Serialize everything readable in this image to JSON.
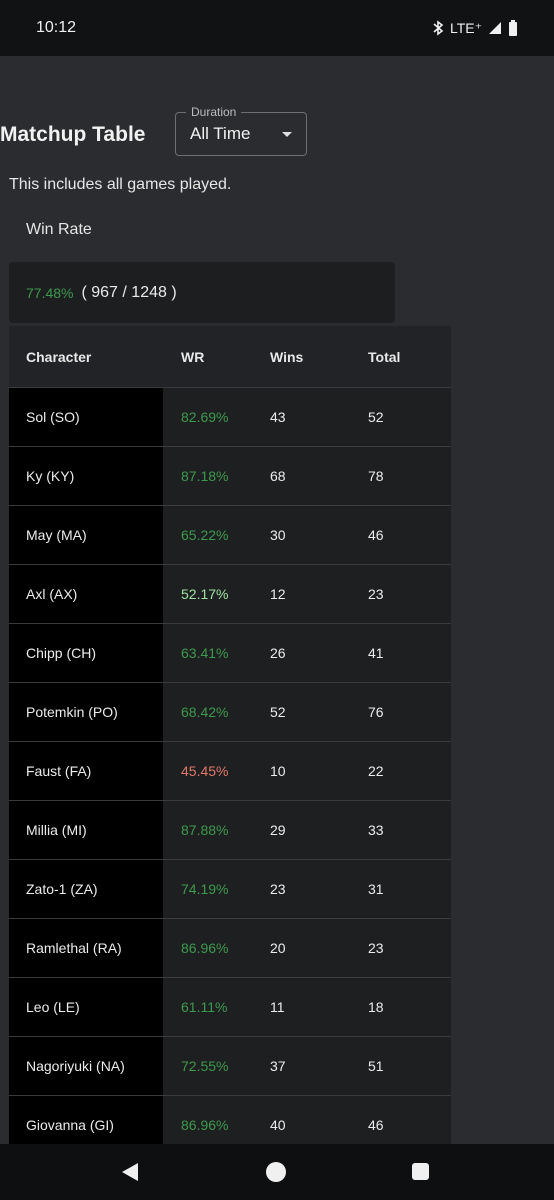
{
  "status": {
    "time": "10:12",
    "network": "LTE⁺"
  },
  "page": {
    "title": "Matchup Table",
    "description": "This includes all games played.",
    "winrate_label": "Win Rate"
  },
  "duration": {
    "label": "Duration",
    "value": "All Time"
  },
  "summary": {
    "pct": "77.48%",
    "count": "( 967 / 1248 )"
  },
  "table": {
    "headers": [
      "Character",
      "WR",
      "Wins",
      "Total"
    ],
    "rows": [
      {
        "character": "Sol (SO)",
        "wr": "82.69%",
        "wins": "43",
        "total": "52",
        "tone": "green"
      },
      {
        "character": "Ky (KY)",
        "wr": "87.18%",
        "wins": "68",
        "total": "78",
        "tone": "green"
      },
      {
        "character": "May (MA)",
        "wr": "65.22%",
        "wins": "30",
        "total": "46",
        "tone": "green"
      },
      {
        "character": "Axl (AX)",
        "wr": "52.17%",
        "wins": "12",
        "total": "23",
        "tone": "light"
      },
      {
        "character": "Chipp (CH)",
        "wr": "63.41%",
        "wins": "26",
        "total": "41",
        "tone": "green"
      },
      {
        "character": "Potemkin (PO)",
        "wr": "68.42%",
        "wins": "52",
        "total": "76",
        "tone": "green"
      },
      {
        "character": "Faust (FA)",
        "wr": "45.45%",
        "wins": "10",
        "total": "22",
        "tone": "red"
      },
      {
        "character": "Millia (MI)",
        "wr": "87.88%",
        "wins": "29",
        "total": "33",
        "tone": "green"
      },
      {
        "character": "Zato-1 (ZA)",
        "wr": "74.19%",
        "wins": "23",
        "total": "31",
        "tone": "green"
      },
      {
        "character": "Ramlethal (RA)",
        "wr": "86.96%",
        "wins": "20",
        "total": "23",
        "tone": "green"
      },
      {
        "character": "Leo (LE)",
        "wr": "61.11%",
        "wins": "11",
        "total": "18",
        "tone": "green"
      },
      {
        "character": "Nagoriyuki (NA)",
        "wr": "72.55%",
        "wins": "37",
        "total": "51",
        "tone": "green"
      },
      {
        "character": "Giovanna (GI)",
        "wr": "86.96%",
        "wins": "40",
        "total": "46",
        "tone": "green"
      }
    ]
  },
  "colors": {
    "green": "#3d9a4d",
    "light": "#9ee3a1",
    "red": "#e2786a"
  }
}
